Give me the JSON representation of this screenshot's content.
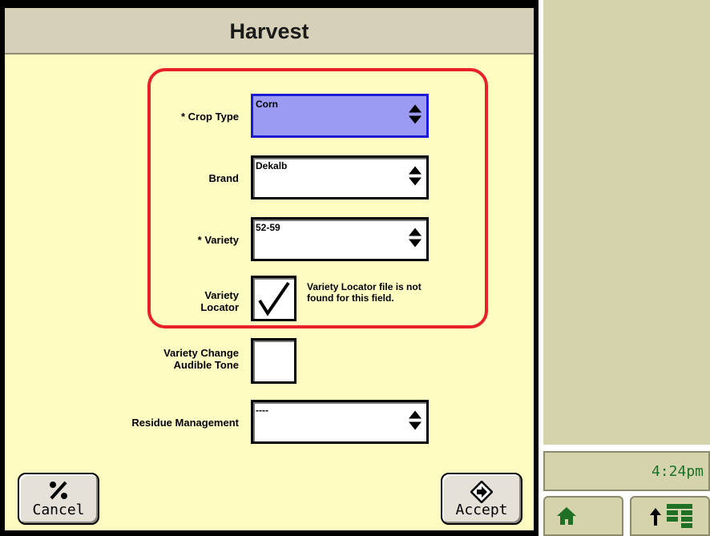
{
  "dialog": {
    "title": "Harvest"
  },
  "fields": {
    "crop_type": {
      "label": "* Crop Type",
      "value": "Corn"
    },
    "brand": {
      "label": "Brand",
      "value": "Dekalb"
    },
    "variety": {
      "label": "* Variety",
      "value": "52-59"
    },
    "variety_locator": {
      "label_line1": "Variety",
      "label_line2": "Locator",
      "checked": true,
      "note_line1": "Variety Locator file is not",
      "note_line2": "found for this field."
    },
    "variety_change_tone": {
      "label_line1": "Variety Change",
      "label_line2": "Audible Tone",
      "checked": false
    },
    "residue_management": {
      "label": "Residue Management",
      "value": "----"
    }
  },
  "buttons": {
    "cancel": "Cancel",
    "accept": "Accept"
  },
  "status": {
    "time": "4:24pm"
  },
  "colors": {
    "dialog_bg": "#fffcc2",
    "titlebar": "#d6d0b8",
    "highlight": "#e8202a",
    "active_select": "#9b9bf3",
    "side_panel": "#d5d3ac",
    "clock_text": "#1f6f25"
  },
  "icons": {
    "updown": "up-down-arrow-icon",
    "cancel": "cancel-icon",
    "accept": "accept-icon",
    "home": "home-icon",
    "menu": "layout-menu-icon"
  }
}
